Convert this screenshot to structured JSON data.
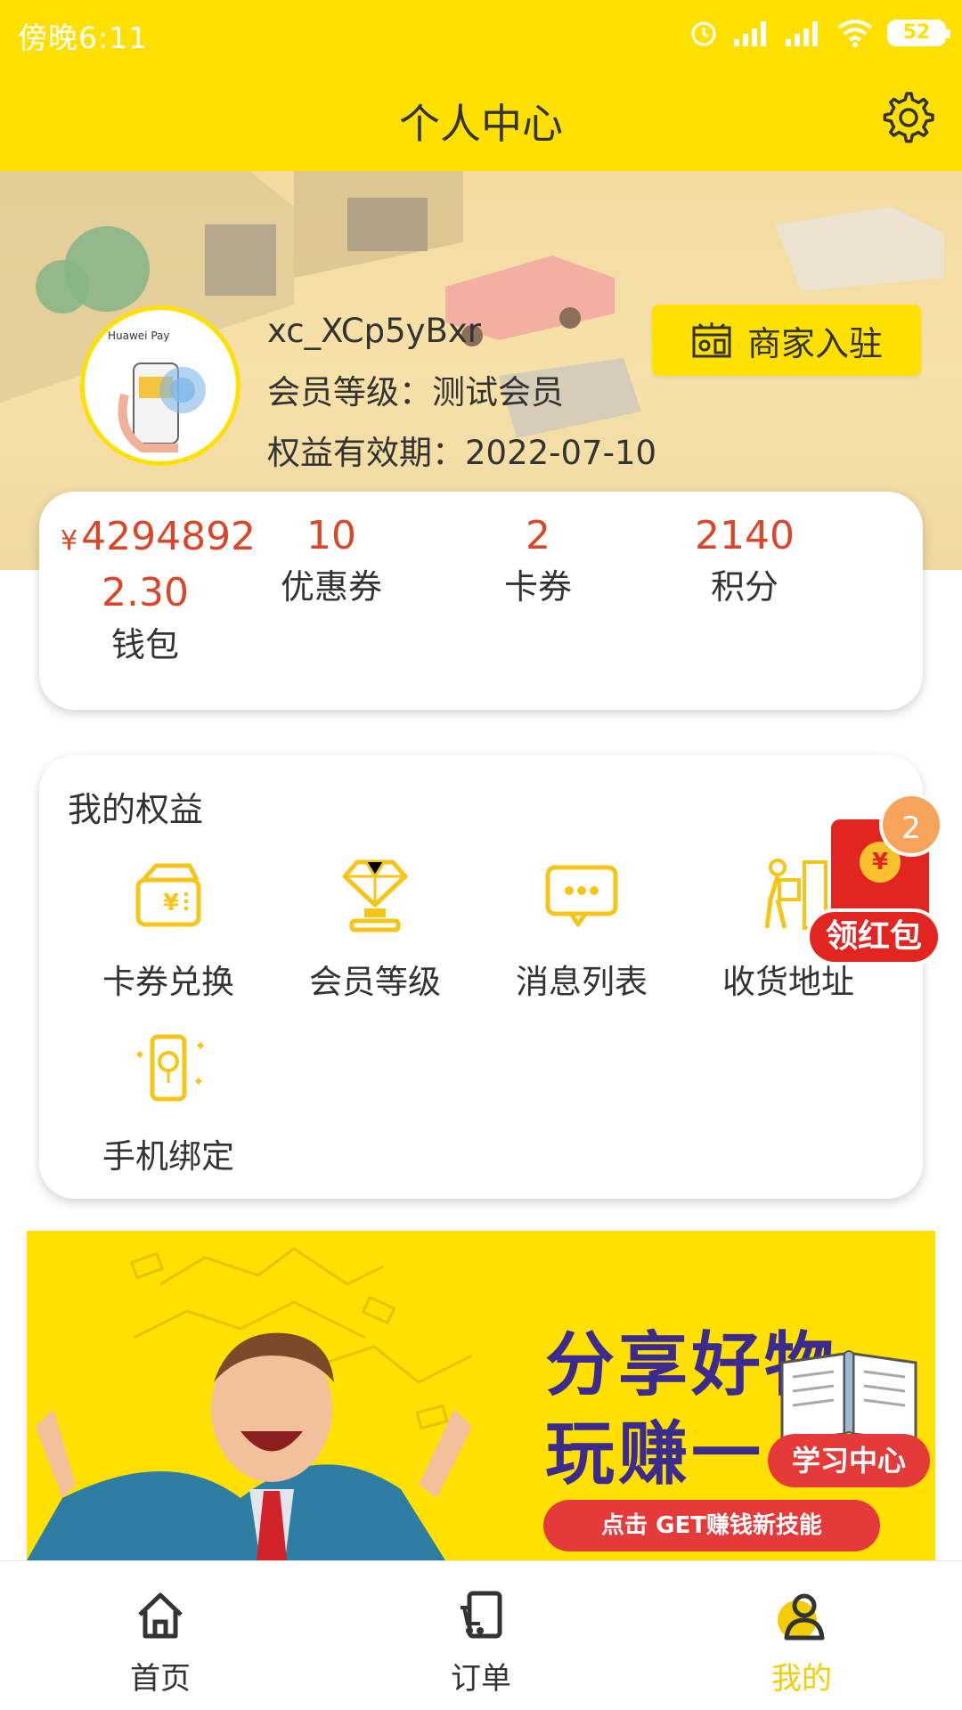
{
  "status_bar": {
    "time": "傍晚6:11",
    "battery": "52"
  },
  "header": {
    "title": "个人中心",
    "settings_icon": "gear-icon"
  },
  "profile": {
    "username": "xc_XCp5yBxr",
    "member_level": "会员等级：测试会员",
    "expiry": "权益有效期：2022-07-10",
    "avatar_text": "Huawei Pay",
    "merchant_button": "商家入驻"
  },
  "stats": {
    "wallet": {
      "currency": "¥",
      "value_line1": "4294892",
      "value_line2": "2.30",
      "label": "钱包"
    },
    "coupons": {
      "value": "10",
      "label": "优惠券"
    },
    "cards": {
      "value": "2",
      "label": "卡券"
    },
    "points": {
      "value": "2140",
      "label": "积分"
    }
  },
  "benefits": {
    "title": "我的权益",
    "items": [
      {
        "label": "卡券兑换",
        "icon": "wallet-coupon-icon"
      },
      {
        "label": "会员等级",
        "icon": "diamond-trophy-icon"
      },
      {
        "label": "消息列表",
        "icon": "chat-bubble-icon"
      },
      {
        "label": "收货地址",
        "icon": "delivery-person-icon"
      },
      {
        "label": "手机绑定",
        "icon": "phone-balloon-icon"
      }
    ]
  },
  "red_packet": {
    "badge": "2",
    "coin": "¥",
    "label": "领红包"
  },
  "promo": {
    "line1": "分享好物",
    "line2": "玩赚一",
    "cta": "点击 GET赚钱新技能",
    "learn_center": "学习中心"
  },
  "tabs": [
    {
      "label": "首页",
      "icon": "home-icon",
      "active": false
    },
    {
      "label": "订单",
      "icon": "order-icon",
      "active": false
    },
    {
      "label": "我的",
      "icon": "user-icon",
      "active": true
    }
  ],
  "colors": {
    "accent": "#FFE001",
    "price": "#D9472B",
    "active_tab": "#F3CC0A",
    "red": "#E32522"
  }
}
